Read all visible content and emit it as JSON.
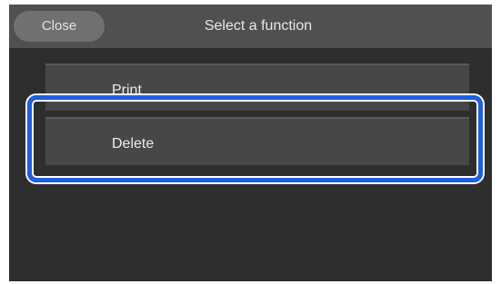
{
  "header": {
    "close_label": "Close",
    "title": "Select a function"
  },
  "menu": {
    "items": [
      {
        "label": "Print"
      },
      {
        "label": "Delete"
      }
    ],
    "highlighted_item": "Delete"
  },
  "colors": {
    "screen_background": "#2e2e2e",
    "header_background": "#505050",
    "item_background": "#474747",
    "highlight_border": "#1f5fe0"
  }
}
